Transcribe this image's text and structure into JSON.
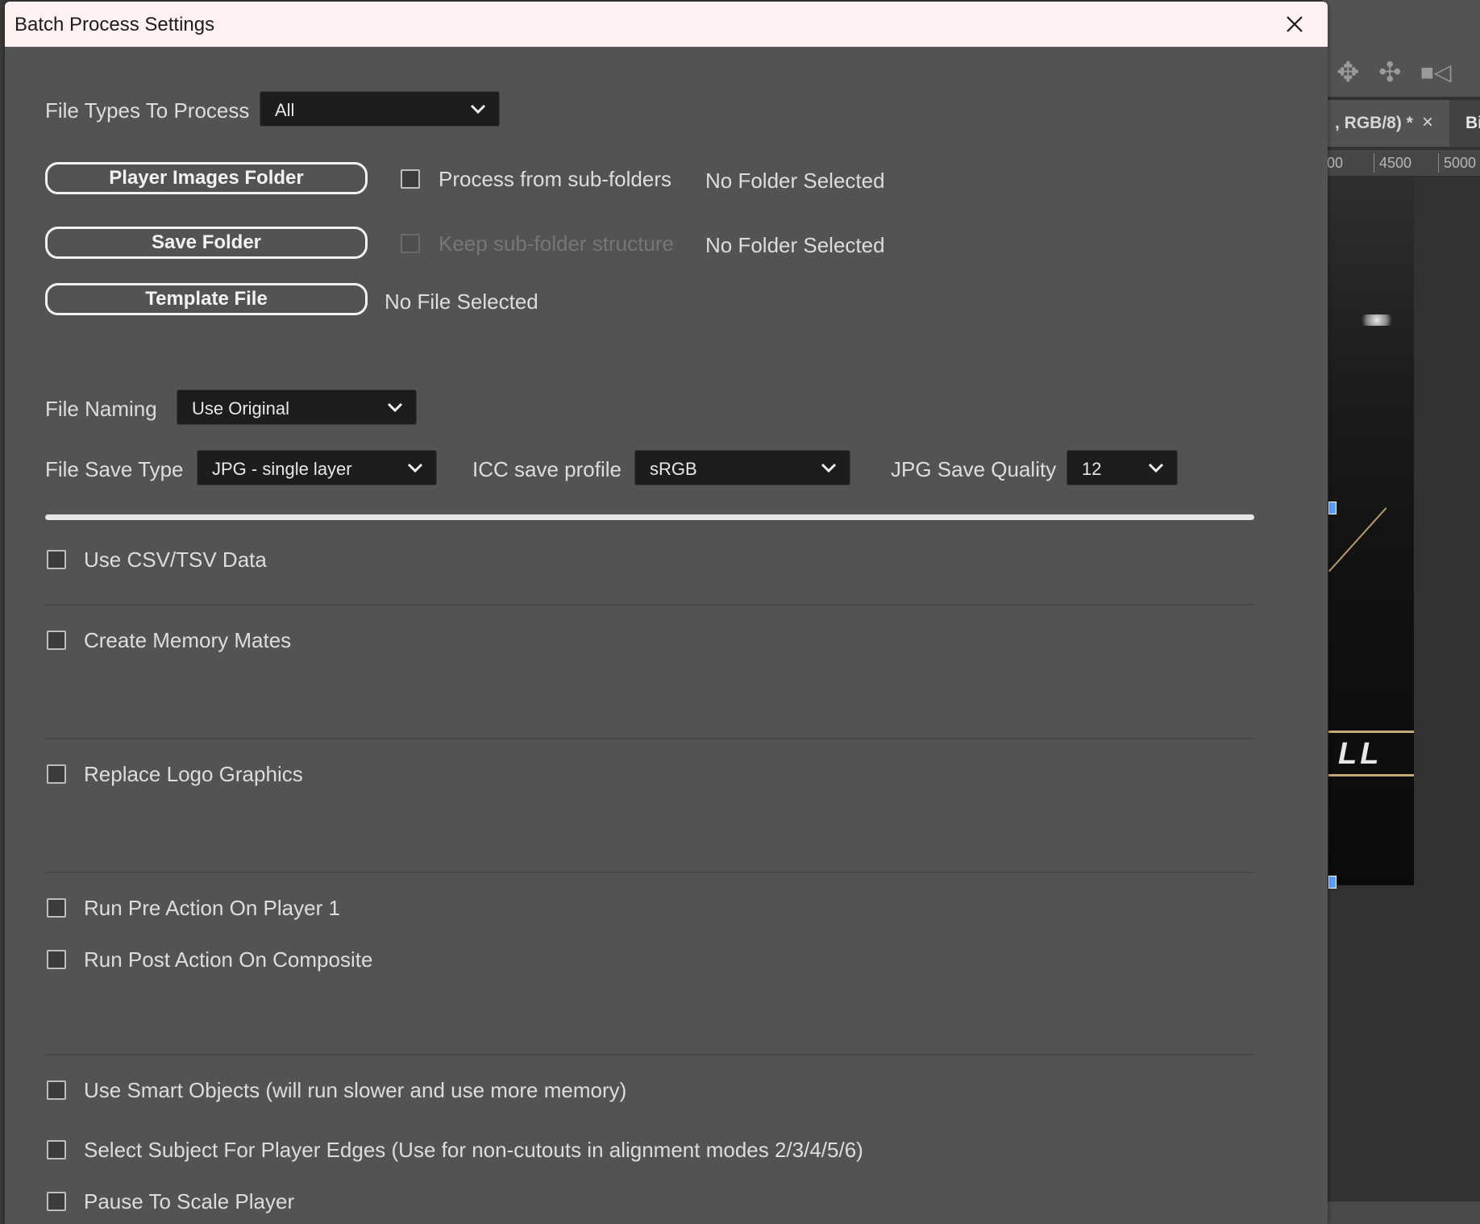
{
  "dialog": {
    "title": "Batch Process Settings"
  },
  "file_types": {
    "label": "File Types To Process",
    "value": "All"
  },
  "folders": {
    "player_images_button": "Player Images Folder",
    "process_subfolders_label": "Process from sub-folders",
    "player_images_status": "No Folder Selected",
    "save_folder_button": "Save Folder",
    "keep_structure_label": "Keep sub-folder structure",
    "save_folder_status": "No Folder Selected",
    "template_file_button": "Template File",
    "template_file_status": "No File Selected"
  },
  "naming": {
    "label": "File Naming",
    "value": "Use Original"
  },
  "save": {
    "type_label": "File Save Type",
    "type_value": "JPG - single layer",
    "icc_label": "ICC save profile",
    "icc_value": "sRGB",
    "quality_label": "JPG Save Quality",
    "quality_value": "12"
  },
  "progress": {
    "value_percent": 100
  },
  "options": {
    "csv": "Use CSV/TSV Data",
    "memory_mates": "Create Memory Mates",
    "replace_logo": "Replace Logo Graphics",
    "pre_action": "Run Pre Action On Player 1",
    "post_action": "Run Post Action On Composite",
    "smart_objects": "Use Smart Objects (will run slower and use more memory)",
    "select_subject": "Select Subject For Player Edges (Use for non-cutouts in alignment modes 2/3/4/5/6)",
    "pause_scale": "Pause To Scale Player"
  },
  "background_app": {
    "tab_label": ", RGB/8) *",
    "tab2_label": "Bi",
    "ruler_ticks": [
      "00",
      "4500",
      "5000"
    ],
    "canvas_text": "LL",
    "icons": [
      "move-icon",
      "pan-icon",
      "video-camera-icon",
      "close-icon"
    ]
  }
}
